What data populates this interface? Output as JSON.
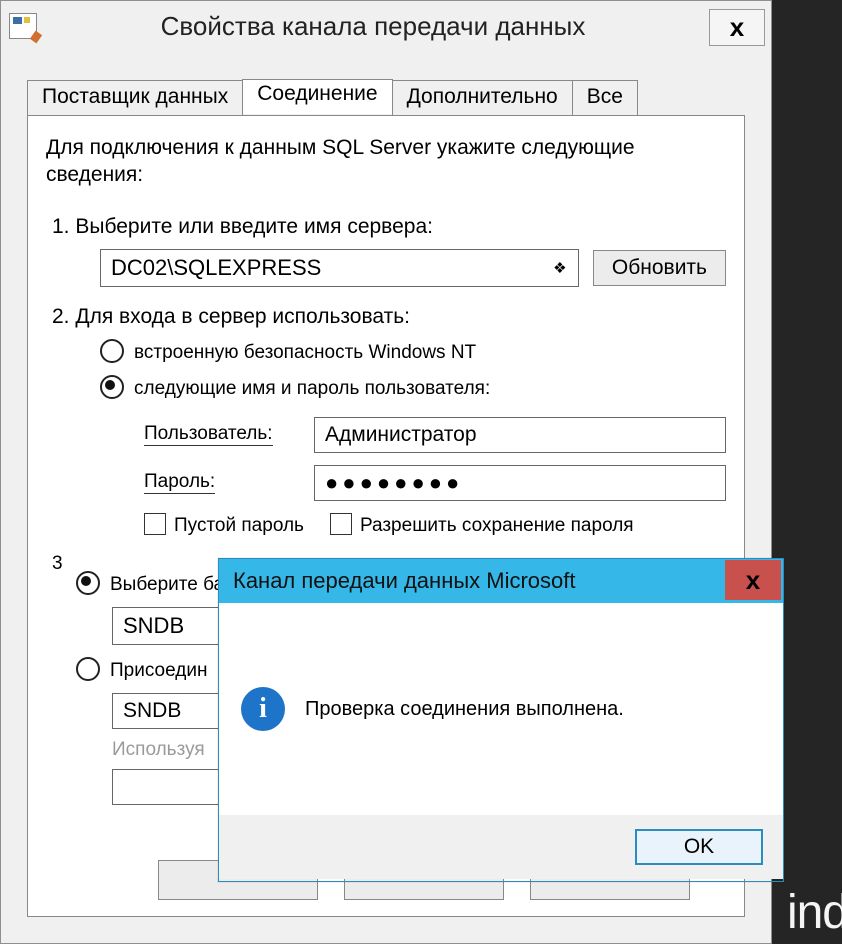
{
  "window": {
    "title": "Свойства канала передачи данных",
    "close": "x"
  },
  "tabs": {
    "provider": "Поставщик данных",
    "connection": "Соединение",
    "advanced": "Дополнительно",
    "all": "Все"
  },
  "text": {
    "instructions": "Для подключения к данным SQL Server укажите следующие сведения:",
    "step1": "1. Выберите или введите имя сервера:",
    "server_value": "DC02\\SQLEXPRESS",
    "refresh": "Обновить",
    "step2": "2. Для входа в сервер использовать:",
    "opt_winauth": "встроенную безопасность Windows NT",
    "opt_userpass": "следующие имя и пароль пользователя:",
    "user_label": "Пользователь:",
    "user_value": "Администратор",
    "pass_label": "Пароль:",
    "pass_value": "●●●●●●●●",
    "blank_pw": "Пустой пароль",
    "allow_save": "Разрешить сохранение пароля",
    "step3_num": "3",
    "step3a": "Выберите базу данных на сервере:",
    "db_value": "SNDB",
    "step3b": "Присоедин",
    "file_value": "SNDB",
    "using": "Используя"
  },
  "msg": {
    "title": "Канал передачи данных Microsoft",
    "close": "x",
    "body": "Проверка соединения выполнена.",
    "ok": "OK"
  },
  "watermark": "ind"
}
